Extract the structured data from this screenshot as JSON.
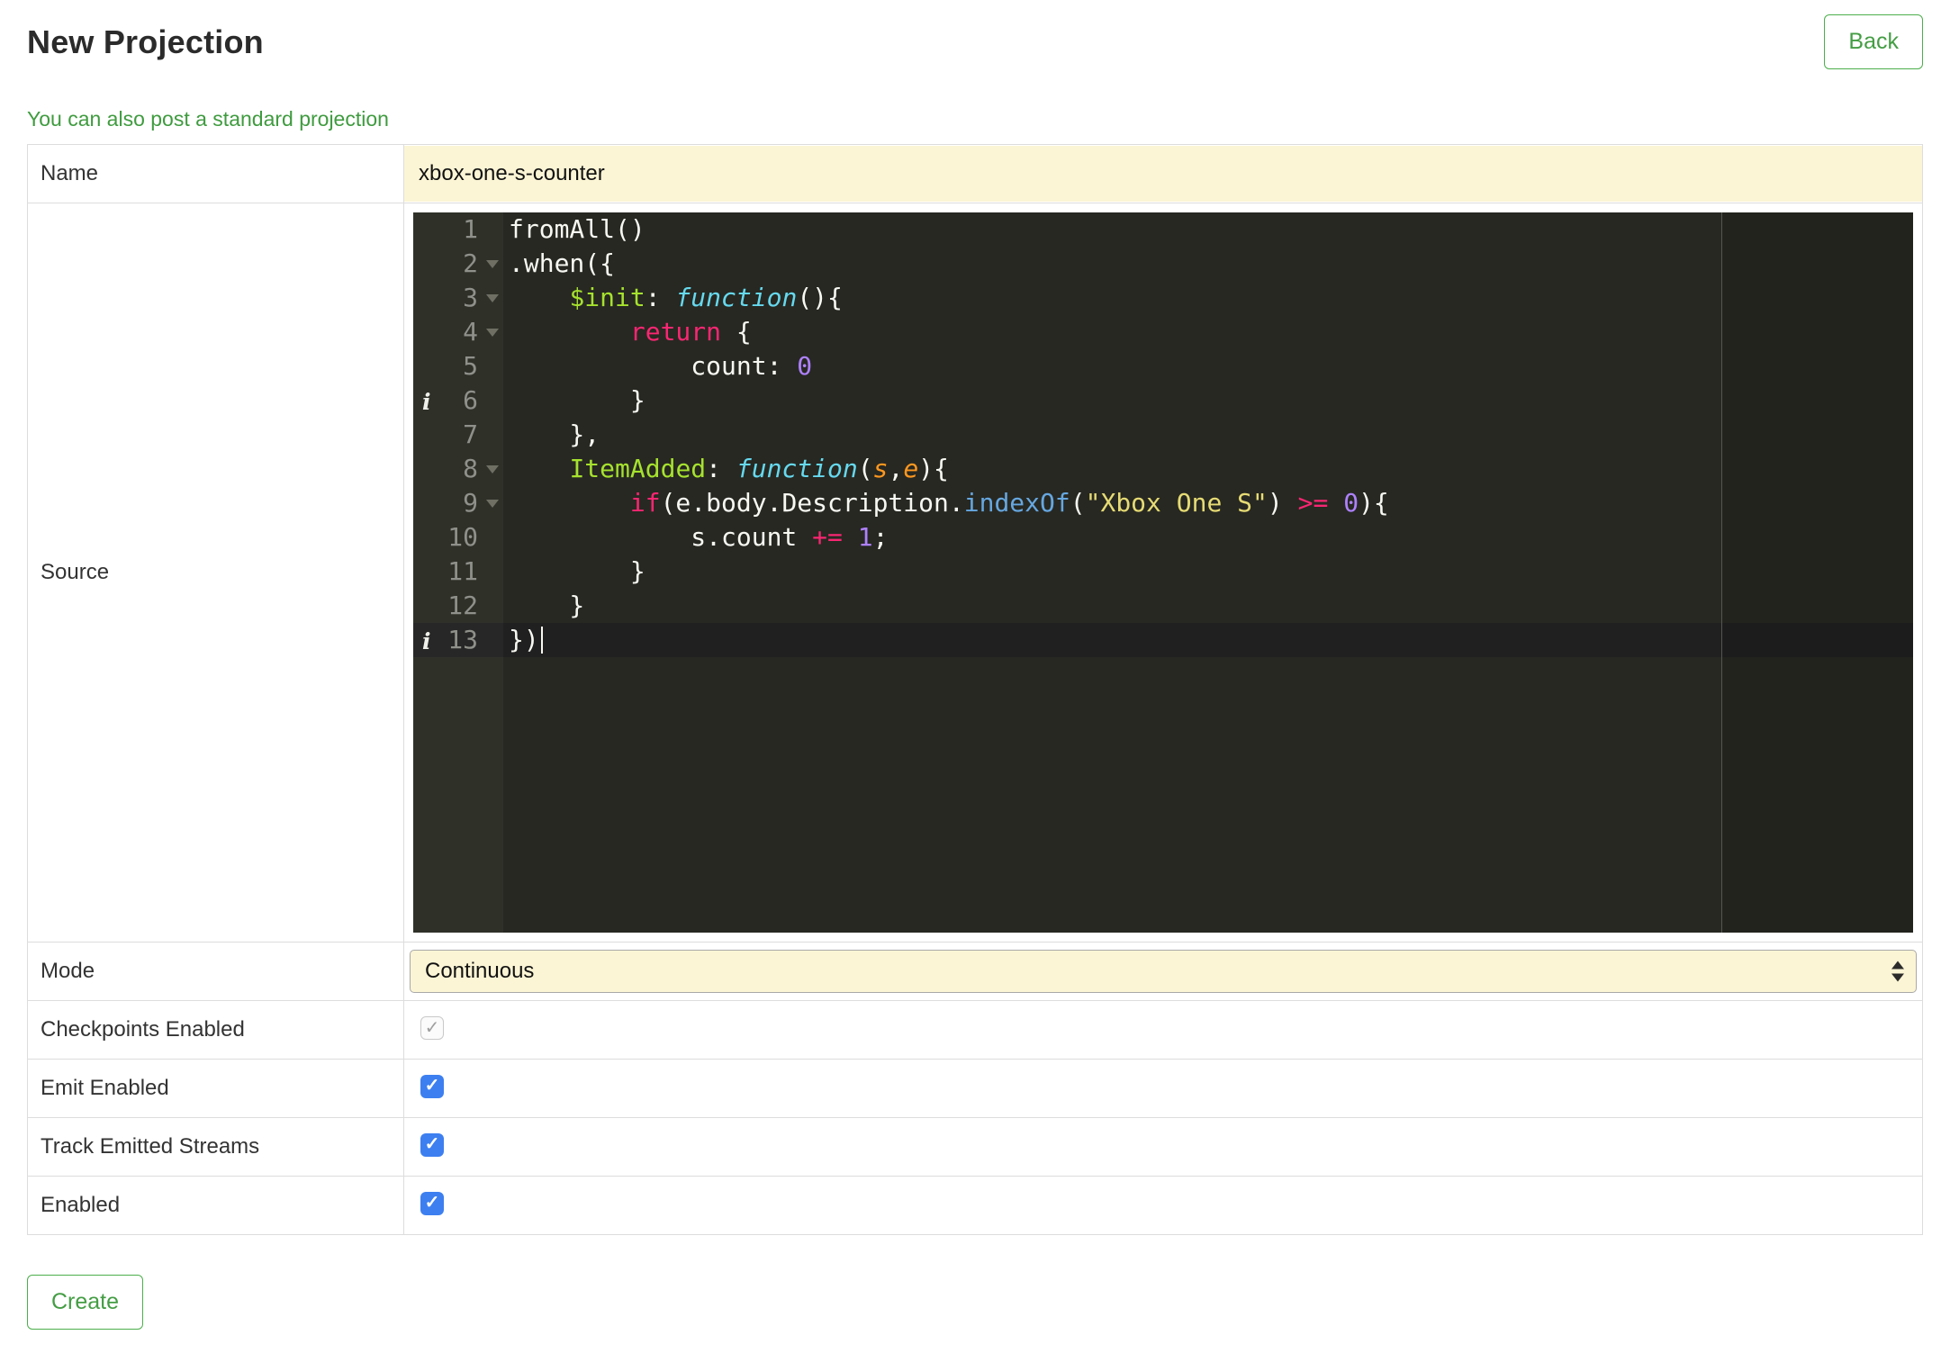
{
  "page": {
    "title": "New Projection",
    "back_button": "Back",
    "standard_projection_link": "You can also post a standard projection",
    "create_button": "Create"
  },
  "form": {
    "name": {
      "label": "Name",
      "value": "xbox-one-s-counter"
    },
    "source": {
      "label": "Source"
    },
    "mode": {
      "label": "Mode",
      "value": "Continuous"
    },
    "checkbox_rows": [
      {
        "label": "Checkpoints Enabled",
        "checked": true,
        "disabled": true
      },
      {
        "label": "Emit Enabled",
        "checked": true,
        "disabled": false
      },
      {
        "label": "Track Emitted Streams",
        "checked": true,
        "disabled": false
      },
      {
        "label": "Enabled",
        "checked": true,
        "disabled": false
      }
    ]
  },
  "colors": {
    "accent_green": "#449d44",
    "field_yellow": "#FBF5D5",
    "checkbox_blue": "#3D7FF0",
    "editor_background": "#272822",
    "gutter_background": "#2F3129",
    "keyword_pink": "#F92672",
    "string_yellow": "#E6DB74",
    "number_purple": "#AE81FF",
    "function_cyan": "#66D9EF",
    "entity_green": "#A6E22E",
    "param_orange": "#FD971F"
  },
  "editor": {
    "active_line": 13,
    "print_margin_col": 80,
    "lines": [
      {
        "n": 1,
        "tokens": [
          [
            "p",
            "fromAll()"
          ]
        ]
      },
      {
        "n": 2,
        "fold": true,
        "tokens": [
          [
            "p",
            ".when({"
          ]
        ]
      },
      {
        "n": 3,
        "fold": true,
        "tokens": [
          [
            "p",
            "    "
          ],
          [
            "e",
            "$init"
          ],
          [
            "p",
            ": "
          ],
          [
            "f",
            "function"
          ],
          [
            "p",
            "(){"
          ]
        ]
      },
      {
        "n": 4,
        "fold": true,
        "tokens": [
          [
            "p",
            "        "
          ],
          [
            "k",
            "return"
          ],
          [
            "p",
            " {"
          ]
        ]
      },
      {
        "n": 5,
        "tokens": [
          [
            "p",
            "            count: "
          ],
          [
            "n",
            "0"
          ]
        ]
      },
      {
        "n": 6,
        "ann": true,
        "tokens": [
          [
            "p",
            "        }"
          ]
        ]
      },
      {
        "n": 7,
        "tokens": [
          [
            "p",
            "    },"
          ]
        ]
      },
      {
        "n": 8,
        "fold": true,
        "tokens": [
          [
            "p",
            "    "
          ],
          [
            "e",
            "ItemAdded"
          ],
          [
            "p",
            ": "
          ],
          [
            "f",
            "function"
          ],
          [
            "p",
            "("
          ],
          [
            "v",
            "s"
          ],
          [
            "p",
            ","
          ],
          [
            "v",
            "e"
          ],
          [
            "p",
            "){"
          ]
        ]
      },
      {
        "n": 9,
        "fold": true,
        "tokens": [
          [
            "p",
            "        "
          ],
          [
            "k",
            "if"
          ],
          [
            "p",
            "(e.body.Description."
          ],
          [
            "sf",
            "indexOf"
          ],
          [
            "p",
            "("
          ],
          [
            "s",
            "\"Xbox One S\""
          ],
          [
            "p",
            ") "
          ],
          [
            "k",
            ">="
          ],
          [
            "p",
            " "
          ],
          [
            "n",
            "0"
          ],
          [
            "p",
            "){"
          ]
        ]
      },
      {
        "n": 10,
        "tokens": [
          [
            "p",
            "            s.count "
          ],
          [
            "k",
            "+="
          ],
          [
            "p",
            " "
          ],
          [
            "n",
            "1"
          ],
          [
            "p",
            ";"
          ]
        ]
      },
      {
        "n": 11,
        "tokens": [
          [
            "p",
            "        }"
          ]
        ]
      },
      {
        "n": 12,
        "tokens": [
          [
            "p",
            "    }"
          ]
        ]
      },
      {
        "n": 13,
        "ann": true,
        "cursor": true,
        "tokens": [
          [
            "p",
            "})"
          ]
        ]
      }
    ]
  }
}
